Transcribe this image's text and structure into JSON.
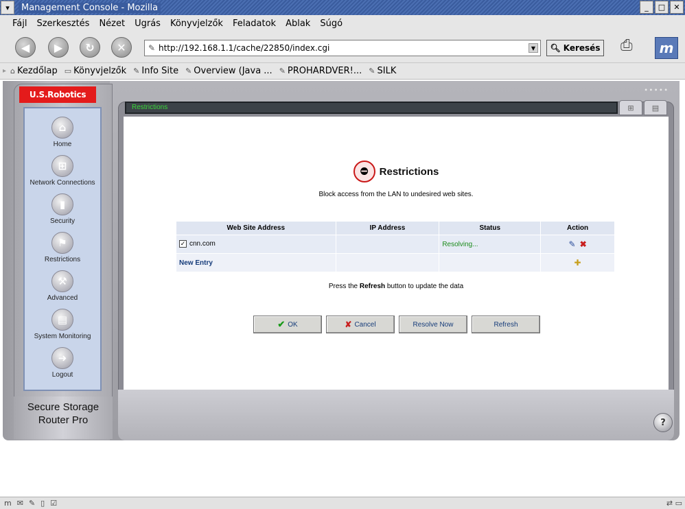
{
  "window": {
    "title": "Management Console - Mozilla"
  },
  "menu": [
    "Fájl",
    "Szerkesztés",
    "Nézet",
    "Ugrás",
    "Könyvjelzők",
    "Feladatok",
    "Ablak",
    "Súgó"
  ],
  "toolbar": {
    "url": "http://192.168.1.1/cache/22850/index.cgi",
    "search_label": "Keresés"
  },
  "bookmarks": [
    "Kezdőlap",
    "Könyvjelzők",
    "Info Site",
    "Overview (Java ...",
    "PROHARDVER!...",
    "SILK"
  ],
  "brand": {
    "logo": "U.S.Robotics",
    "product_line1": "Secure Storage",
    "product_line2": "Router Pro"
  },
  "sidebar": {
    "items": [
      {
        "label": "Home",
        "icon": "home-icon"
      },
      {
        "label": "Network Connections",
        "icon": "network-icon"
      },
      {
        "label": "Security",
        "icon": "lock-icon"
      },
      {
        "label": "Restrictions",
        "icon": "restrictions-icon"
      },
      {
        "label": "Advanced",
        "icon": "tools-icon"
      },
      {
        "label": "System Monitoring",
        "icon": "monitor-icon"
      },
      {
        "label": "Logout",
        "icon": "logout-icon"
      }
    ]
  },
  "statusbar_text": "Restrictions",
  "page": {
    "title": "Restrictions",
    "description": "Block access from the LAN to undesired web sites.",
    "table": {
      "headers": [
        "Web Site Address",
        "IP Address",
        "Status",
        "Action"
      ],
      "rows": [
        {
          "address": "cnn.com",
          "ip": "",
          "status": "Resolving..."
        }
      ],
      "new_entry": "New Entry"
    },
    "hint_prefix": "Press the",
    "hint_bold": "Refresh",
    "hint_suffix": "button to update the data",
    "buttons": {
      "ok": "OK",
      "cancel": "Cancel",
      "resolve": "Resolve Now",
      "refresh": "Refresh"
    }
  },
  "colors": {
    "accent_red": "#e41b1b",
    "status_green": "#1a8a1a",
    "nav_panel": "#c9d5ea"
  }
}
